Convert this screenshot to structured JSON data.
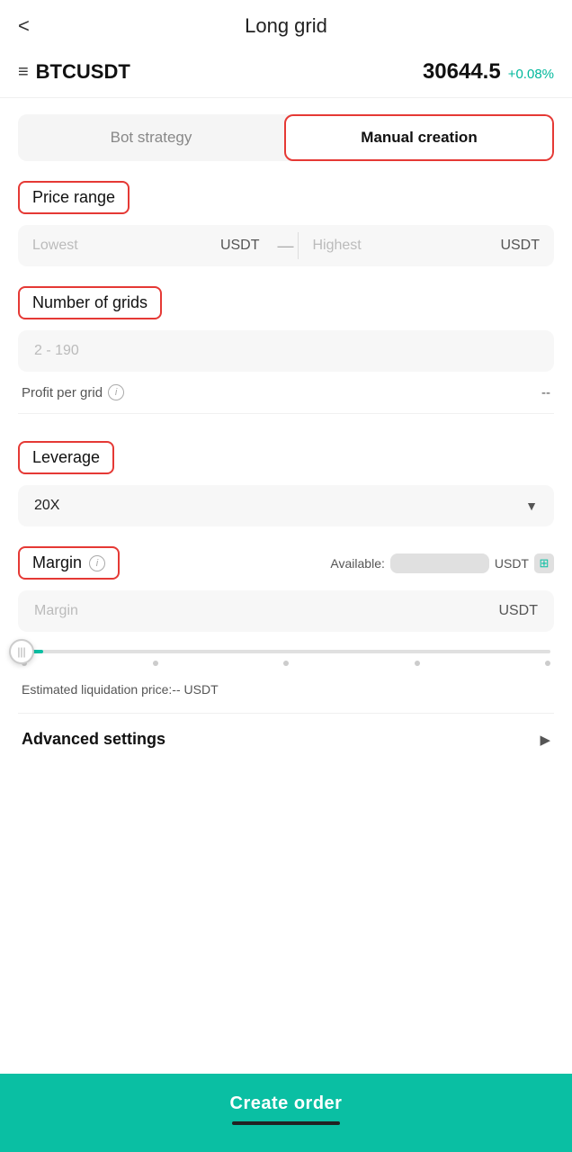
{
  "header": {
    "back_label": "<",
    "title": "Long grid"
  },
  "symbol": {
    "name": "BTCUSDT",
    "price": "30644.5",
    "change": "+0.08%"
  },
  "tabs": [
    {
      "id": "bot_strategy",
      "label": "Bot strategy",
      "active": false
    },
    {
      "id": "manual_creation",
      "label": "Manual creation",
      "active": true
    }
  ],
  "price_range": {
    "section_label": "Price range",
    "lowest_placeholder": "Lowest",
    "lowest_unit": "USDT",
    "separator": "—",
    "highest_placeholder": "Highest",
    "highest_unit": "USDT"
  },
  "number_of_grids": {
    "section_label": "Number of grids",
    "placeholder": "2 - 190"
  },
  "profit_per_grid": {
    "label": "Profit per grid",
    "value": "--"
  },
  "leverage": {
    "section_label": "Leverage",
    "value": "20X"
  },
  "margin": {
    "section_label": "Margin",
    "available_label": "Available:",
    "available_unit": "USDT",
    "placeholder": "Margin",
    "unit": "USDT"
  },
  "liquidation": {
    "text": "Estimated liquidation price:-- USDT"
  },
  "advanced_settings": {
    "label": "Advanced settings"
  },
  "create_order": {
    "label": "Create order"
  },
  "icons": {
    "info": "i",
    "chevron_down": "▼",
    "chevron_right": "▶",
    "copy": "⊞",
    "slider_thumb": "|||",
    "hamburger": "≡"
  }
}
